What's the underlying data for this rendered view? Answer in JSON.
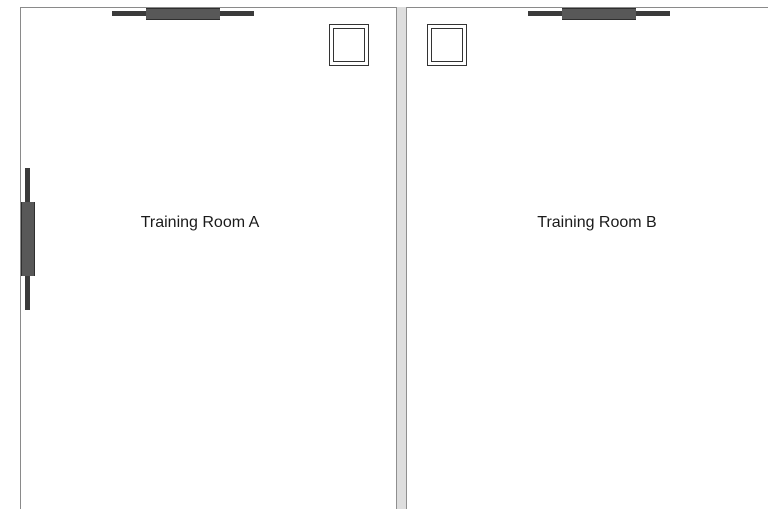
{
  "rooms": [
    {
      "label": "Training Room A"
    },
    {
      "label": "Training Room B"
    }
  ],
  "colors": {
    "wall": "#8a8a8a",
    "partition_fill": "#dedede",
    "fixture_dark": "#3b3b3b",
    "fixture_core": "#585858",
    "label_text": "#1a1a1a"
  }
}
